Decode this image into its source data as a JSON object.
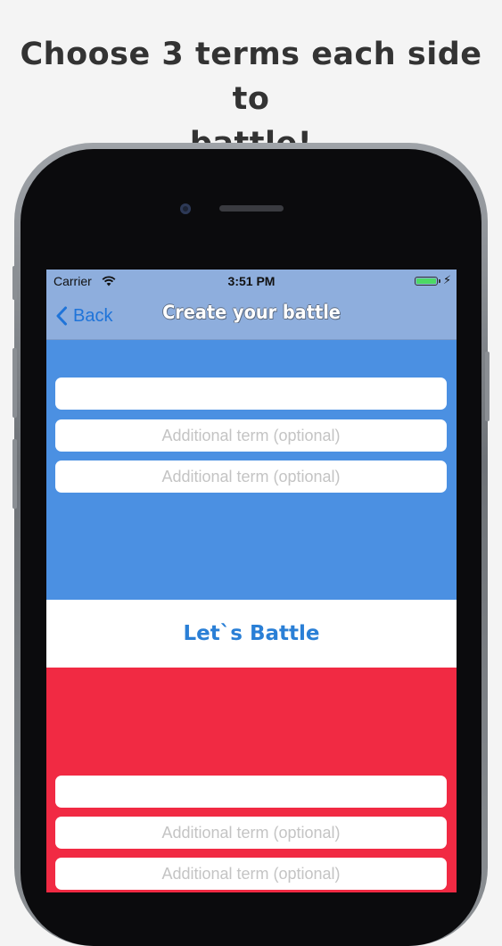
{
  "headline": {
    "line1": "Choose 3 terms each side to",
    "line2": "battle!"
  },
  "status_bar": {
    "carrier": "Carrier",
    "time": "3:51 PM",
    "battery_level": 1.0
  },
  "nav": {
    "back_label": "Back",
    "title": "Create your battle"
  },
  "side_a": {
    "color": "#4b90e2",
    "fields": [
      {
        "value": "",
        "placeholder": ""
      },
      {
        "value": "",
        "placeholder": "Additional term (optional)"
      },
      {
        "value": "",
        "placeholder": "Additional term (optional)"
      }
    ]
  },
  "battle_button": {
    "label": "Let`s Battle",
    "color": "#2a7fd6"
  },
  "side_b": {
    "color": "#f12a43",
    "fields": [
      {
        "value": "",
        "placeholder": ""
      },
      {
        "value": "",
        "placeholder": "Additional term (optional)"
      },
      {
        "value": "",
        "placeholder": "Additional term (optional)"
      }
    ]
  }
}
